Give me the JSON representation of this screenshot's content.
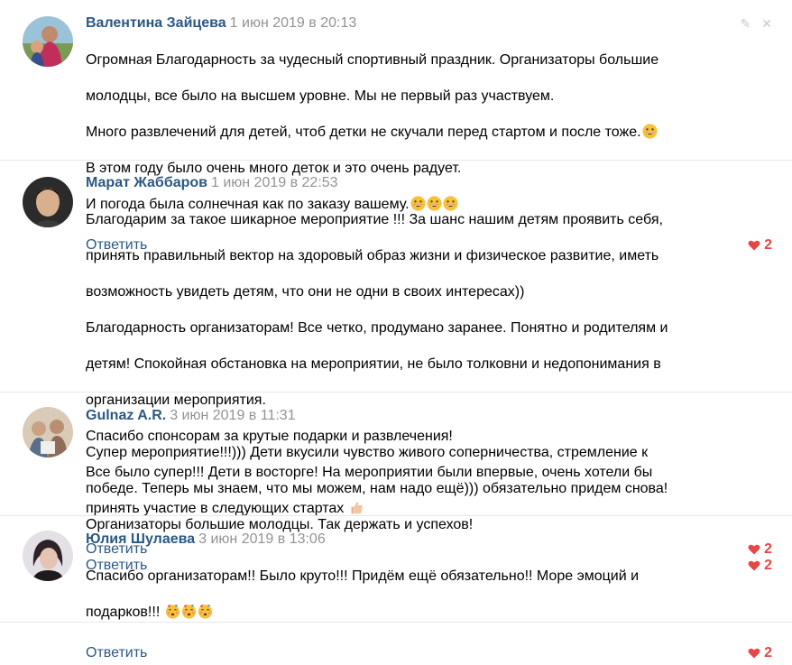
{
  "colors": {
    "author": "#2a5885",
    "date": "#939393",
    "like": "#e64646",
    "divider": "#e7e8ec"
  },
  "comments": [
    {
      "author": "Валентина Зайцева",
      "date": "1 июн 2019 в 20:13",
      "lines": [
        "Огромная Благодарность за чудесный спортивный праздник. Организаторы большие",
        "молодцы, все было на высшем уровне. Мы не первый раз участвуем.",
        "Много развлечений для детей, чтоб детки не скучали перед стартом и после тоже.",
        "В этом году было очень много деток и это очень радует.",
        "И погода была солнечная как по заказу вашему."
      ],
      "reply_label": "Ответить",
      "likes": "2",
      "icons": [
        "edit-icon",
        "close-icon",
        "grin-emoji"
      ]
    },
    {
      "author": "Марат Жаббаров",
      "date": "1 июн 2019 в 22:53",
      "lines": [
        "Благодарим за такое шикарное мероприятие !!! За шанс нашим детям проявить себя,",
        "принять правильный вектор на здоровый образ жизни и физическое развитие, иметь",
        "возможность увидеть детям, что они не одни в своих интересах))",
        "Благодарность организаторам! Все четко, продумано заранее. Понятно и родителям и",
        "детям! Спокойная обстановка на мероприятии, не было толковни и недопонимания в",
        "организации мероприятия.",
        "Спасибо спонсорам за крутые подарки и развлечения!",
        "Все было супер!!! Дети в восторге! На мероприятии были впервые, очень хотели бы",
        "принять участие в следующих стартах"
      ],
      "reply_label": "Ответить",
      "likes": "2",
      "icons": [
        "thumbs-up-emoji"
      ]
    },
    {
      "author": "Gulnaz A.R.",
      "date": "3 июн 2019 в 11:31",
      "lines": [
        "Супер мероприятие!!!))) Дети вкусили чувство живого соперничества, стремление к",
        "победе. Теперь мы знаем, что мы можем, нам надо ещё))) обязательно придем снова!",
        "Организаторы большие молодцы. Так держать и успехов!"
      ],
      "reply_label": "Ответить",
      "likes": "2"
    },
    {
      "author": "Юлия Шулаева",
      "date": "3 июн 2019 в 13:06",
      "lines": [
        "Спасибо организаторам!! Было круто!!! Придём ещё обязательно!! Море эмоций и",
        "подарков!!!"
      ],
      "reply_label": "Ответить",
      "likes": "2",
      "icons": [
        "party-face-emoji"
      ]
    }
  ]
}
